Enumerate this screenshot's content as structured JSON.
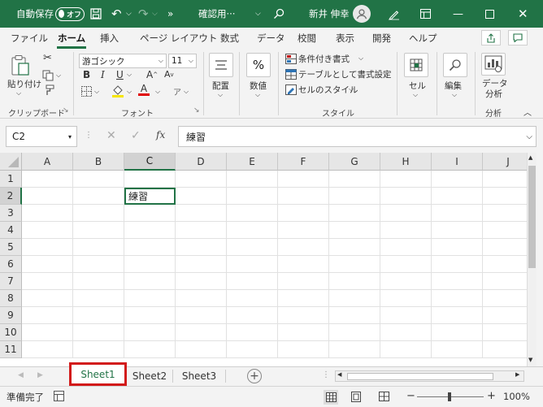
{
  "titlebar": {
    "autosave_label": "自動保存",
    "autosave_state": "オフ",
    "filename": "確認用···",
    "user_name": "新井 伸幸"
  },
  "ribbon_tabs": [
    "ファイル",
    "ホーム",
    "挿入",
    "ページ レイアウト",
    "数式",
    "データ",
    "校閲",
    "表示",
    "開発",
    "ヘルプ"
  ],
  "active_tab": "ホーム",
  "ribbon": {
    "clipboard": {
      "paste_label": "貼り付け",
      "group_label": "クリップボード"
    },
    "font": {
      "font_name": "游ゴシック",
      "font_size": "11",
      "group_label": "フォント"
    },
    "alignment": {
      "label": "配置"
    },
    "number": {
      "label": "数値",
      "symbol": "%"
    },
    "styles": {
      "conditional_format": "条件付き書式",
      "format_as_table": "テーブルとして書式設定",
      "cell_styles": "セルのスタイル",
      "group_label": "スタイル"
    },
    "cells": {
      "label": "セル"
    },
    "editing": {
      "label": "編集"
    },
    "analysis": {
      "label_line1": "データ",
      "label_line2": "分析",
      "group_label": "分析"
    }
  },
  "formula_bar": {
    "name_box": "C2",
    "fx": "fx",
    "content": "練習"
  },
  "columns": [
    "A",
    "B",
    "C",
    "D",
    "E",
    "F",
    "G",
    "H",
    "I",
    "J"
  ],
  "rows": [
    "1",
    "2",
    "3",
    "4",
    "5",
    "6",
    "7",
    "8",
    "9",
    "10",
    "11"
  ],
  "cells": {
    "C2": "練習"
  },
  "sheets": [
    "Sheet1",
    "Sheet2",
    "Sheet3"
  ],
  "active_sheet": "Sheet1",
  "status": {
    "ready": "準備完了",
    "zoom": "100%"
  },
  "colors": {
    "accent": "#217346",
    "highlight": "#d21a1a"
  }
}
